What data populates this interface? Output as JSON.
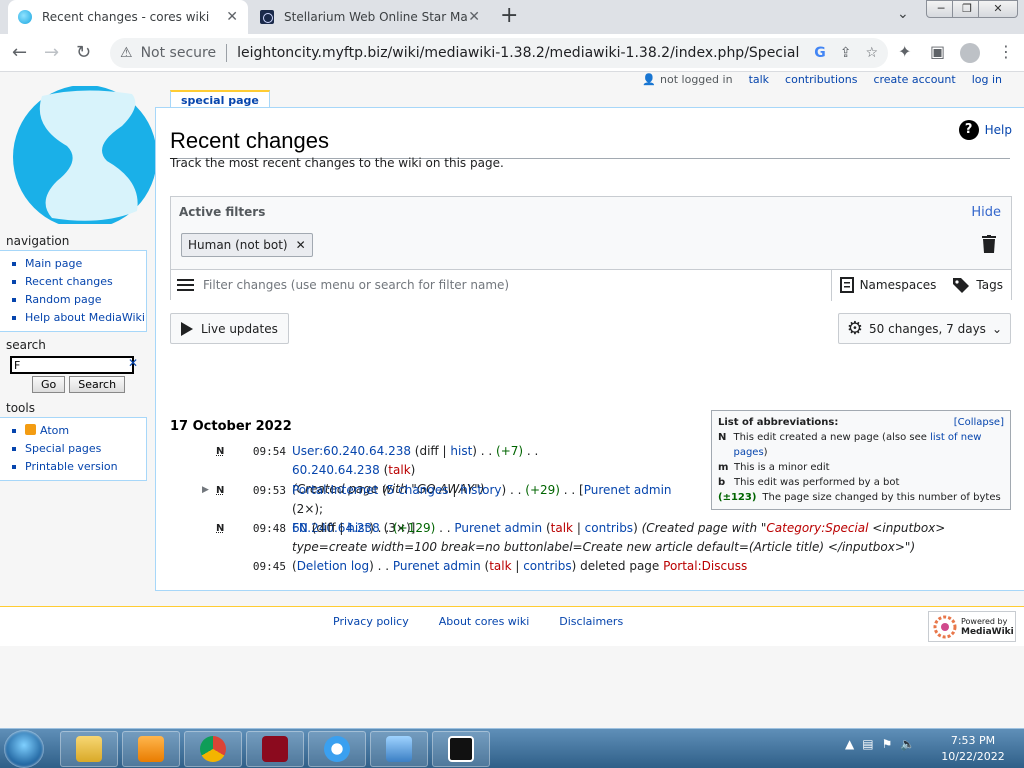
{
  "browser": {
    "tabs": [
      {
        "title": "Recent changes - cores wiki",
        "active": true
      },
      {
        "title": "Stellarium Web Online Star Map",
        "active": false
      }
    ],
    "new_tab": "+",
    "not_secure": "Not secure",
    "url": "leightoncity.myftp.biz/wiki/mediawiki-1.38.2/mediawiki-1.38.2/index.php/Special:Recent..."
  },
  "personal": {
    "not_logged_in": "not logged in",
    "talk": "talk",
    "contributions": "contributions",
    "create_account": "create account",
    "log_in": "log in"
  },
  "sidebar": {
    "navigation": {
      "heading": "navigation",
      "items": [
        "Main page",
        "Recent changes",
        "Random page",
        "Help about MediaWiki"
      ]
    },
    "search": {
      "heading": "search",
      "value": "F",
      "go": "Go",
      "search": "Search"
    },
    "tools": {
      "heading": "tools",
      "items": [
        "Atom",
        "Special pages",
        "Printable version"
      ]
    }
  },
  "content": {
    "tab": "special page",
    "title": "Recent changes",
    "help": "Help",
    "intro": "Track the most recent changes to the wiki on this page.",
    "filters": {
      "title": "Active filters",
      "hide": "Hide",
      "chip": "Human (not bot)",
      "placeholder": "Filter changes (use menu or search for filter name)",
      "namespaces": "Namespaces",
      "tags": "Tags"
    },
    "live_updates": "Live updates",
    "changes_summary": "50 changes, 7 days",
    "date": "17 October 2022",
    "abbreviations": {
      "title": "List of abbreviations:",
      "collapse": "[Collapse]",
      "rows": [
        {
          "key": "N",
          "text": "This edit created a new page (also see ",
          "link": "list of new pages",
          "after": ")"
        },
        {
          "key": "m",
          "text": "This is a minor edit",
          "link": "",
          "after": ""
        },
        {
          "key": "b",
          "text": "This edit was performed by a bot",
          "link": "",
          "after": ""
        },
        {
          "key": "(±123)",
          "text": "The page size changed by this number of bytes",
          "link": "",
          "after": ""
        }
      ]
    },
    "changes": [
      {
        "flag": "N",
        "time": "09:54",
        "page": "User:60.240.64.238",
        "diff": "diff",
        "hist": "hist",
        "size": "(+7)",
        "user": "60.240.64.238",
        "talk": "talk",
        "comment": "(Created page with \"GO AWAY\")"
      },
      {
        "flag": "N",
        "time": "09:53",
        "page": "Portal:Internet",
        "count": "5 changes",
        "hist": "history",
        "size": "(+29)",
        "user1": "Purenet admin",
        "user1_count": "(2×);",
        "user2": "60.240.64.238",
        "user2_count": "(3×)]"
      },
      {
        "flag": "N",
        "time": "09:48",
        "page": "FN",
        "diff": "diff",
        "hist": "hist",
        "size": "(+129)",
        "user": "Purenet admin",
        "talk": "talk",
        "contribs": "contribs",
        "comment_pre": "(Created page with \"",
        "comment_link": "Category:Special",
        "comment_post": " <inputbox> type=create width=100 break=no buttonlabel=Create new article default=(Article title) </inputbox>\")"
      },
      {
        "flag": "",
        "time": "09:45",
        "page": "Deletion log",
        "user": "Purenet admin",
        "talk": "talk",
        "contribs": "contribs",
        "action": "deleted page",
        "target": "Portal:Discuss"
      }
    ]
  },
  "footer": {
    "links": [
      "Privacy policy",
      "About cores wiki",
      "Disclaimers"
    ],
    "powered_line1": "Powered by",
    "powered_line2": "MediaWiki"
  },
  "taskbar": {
    "time": "7:53 PM",
    "date": "10/22/2022"
  }
}
